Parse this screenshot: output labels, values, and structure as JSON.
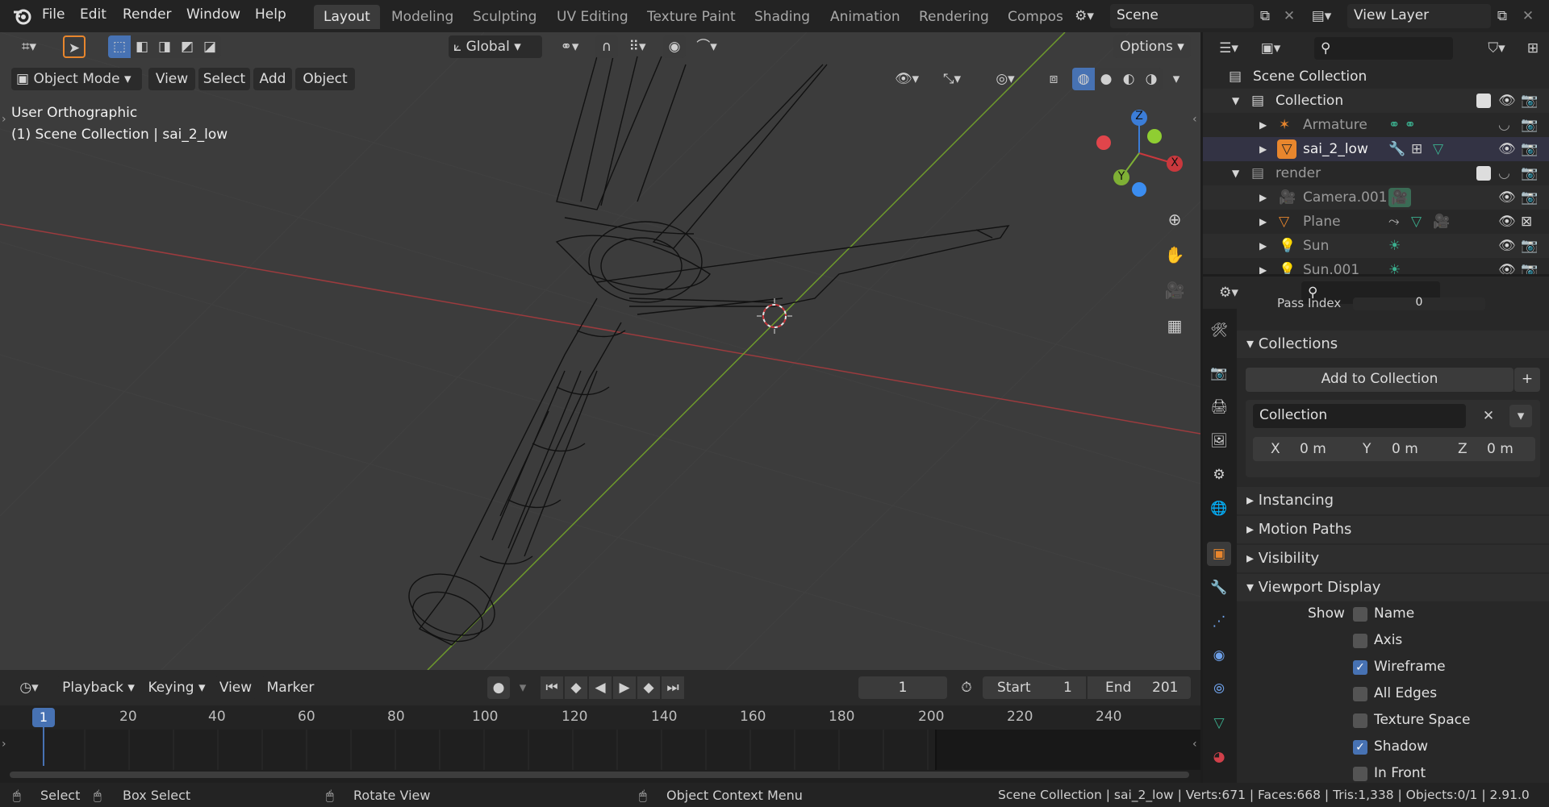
{
  "topbar": {
    "menus": [
      "File",
      "Edit",
      "Render",
      "Window",
      "Help"
    ],
    "workspaces": [
      "Layout",
      "Modeling",
      "Sculpting",
      "UV Editing",
      "Texture Paint",
      "Shading",
      "Animation",
      "Rendering",
      "Compos"
    ],
    "scene_name": "Scene",
    "view_layer": "View Layer"
  },
  "tool_header": {
    "orientation": "Global",
    "options_label": "Options"
  },
  "viewport_header": {
    "mode": "Object Mode",
    "menus": [
      "View",
      "Select",
      "Add",
      "Object"
    ]
  },
  "viewport": {
    "view_name": "User Orthographic",
    "context": "(1) Scene Collection | sai_2_low",
    "gizmo_axes": [
      "Z",
      "Y",
      "X"
    ]
  },
  "outliner": {
    "root": "Scene Collection",
    "rows": [
      {
        "name": "Collection",
        "indent": 1,
        "visible": true
      },
      {
        "name": "Armature",
        "indent": 2,
        "visible": false
      },
      {
        "name": "sai_2_low",
        "indent": 2,
        "visible": true
      },
      {
        "name": "render",
        "indent": 1,
        "visible": false
      },
      {
        "name": "Camera.001",
        "indent": 2,
        "visible": true
      },
      {
        "name": "Plane",
        "indent": 2,
        "visible": true
      },
      {
        "name": "Sun",
        "indent": 2,
        "visible": true
      },
      {
        "name": "Sun.001",
        "indent": 2,
        "visible": true
      }
    ]
  },
  "properties": {
    "cut_label": "Pass Index",
    "cut_value": "0",
    "collections": {
      "title": "Collections",
      "add_button": "Add to Collection",
      "collection_name": "Collection",
      "x_label": "X",
      "x_value": "0 m",
      "y_label": "Y",
      "y_value": "0 m",
      "z_label": "Z",
      "z_value": "0 m"
    },
    "panels": [
      "Instancing",
      "Motion Paths",
      "Visibility",
      "Viewport Display"
    ],
    "viewport_display": {
      "show_label": "Show",
      "options": [
        {
          "label": "Name",
          "checked": false
        },
        {
          "label": "Axis",
          "checked": false
        },
        {
          "label": "Wireframe",
          "checked": true
        },
        {
          "label": "All Edges",
          "checked": false
        },
        {
          "label": "Texture Space",
          "checked": false
        },
        {
          "label": "Shadow",
          "checked": true
        },
        {
          "label": "In Front",
          "checked": false
        }
      ]
    }
  },
  "timeline": {
    "menus": [
      "Playback",
      "Keying",
      "View",
      "Marker"
    ],
    "current_frame": "1",
    "start_label": "Start",
    "start": "1",
    "end_label": "End",
    "end": "201",
    "ticks": [
      "20",
      "40",
      "60",
      "80",
      "100",
      "120",
      "140",
      "160",
      "180",
      "200",
      "220",
      "240"
    ],
    "playhead": "1"
  },
  "statusbar": {
    "select": "Select",
    "box_select": "Box Select",
    "rotate": "Rotate View",
    "context_menu": "Object Context Menu",
    "stats": "Scene Collection | sai_2_low | Verts:671 | Faces:668 | Tris:1,338 | Objects:0/1 | 2.91.0"
  },
  "colors": {
    "accent": "#4772b3",
    "x_axis": "#c9383d",
    "y_axis": "#7fb035",
    "z_axis": "#3b7dd8",
    "active_object": "#e8862d"
  }
}
